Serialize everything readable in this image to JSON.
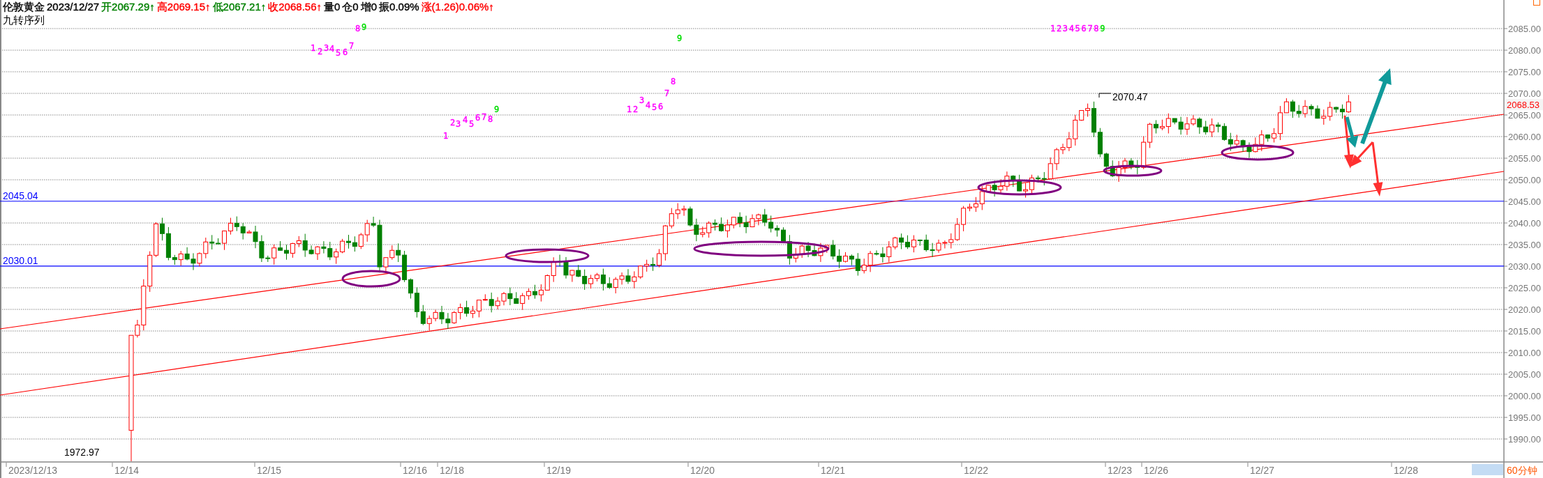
{
  "header": {
    "items": [
      {
        "text": "伦敦黄金",
        "color": "#000000"
      },
      {
        "text": "2023/12/27",
        "color": "#000000"
      },
      {
        "text": "开2067.29↑",
        "color": "#008000"
      },
      {
        "text": "高2069.15↑",
        "color": "#ff0000"
      },
      {
        "text": "低2067.21↑",
        "color": "#008000"
      },
      {
        "text": "收2068.56↑",
        "color": "#ff0000"
      },
      {
        "text": "量0",
        "color": "#000000"
      },
      {
        "text": "仓0",
        "color": "#000000"
      },
      {
        "text": "增0",
        "color": "#000000"
      },
      {
        "text": "振0.09%",
        "color": "#000000"
      },
      {
        "text": "涨(1.26)0.06%↑",
        "color": "#ff0000"
      }
    ],
    "indicator": "九转序列"
  },
  "nine_sequences": [
    {
      "digits": [
        {
          "text": "1",
          "color": "#ff00ff"
        },
        {
          "text": "2",
          "color": "#ff00ff"
        },
        {
          "text": "3",
          "color": "#ff00ff"
        },
        {
          "text": "4",
          "color": "#ff00ff"
        },
        {
          "text": "5",
          "color": "#ff00ff"
        },
        {
          "text": "6",
          "color": "#ff00ff"
        },
        {
          "text": "7",
          "color": "#ff00ff"
        },
        {
          "text": "8",
          "color": "#ff00ff"
        },
        {
          "text": "9",
          "color": "#00dd00"
        }
      ]
    },
    {
      "digits": [
        {
          "text": "1",
          "color": "#ff00ff"
        },
        {
          "text": "2",
          "color": "#ff00ff"
        },
        {
          "text": "3",
          "color": "#ff00ff"
        },
        {
          "text": "4",
          "color": "#ff00ff"
        },
        {
          "text": "5",
          "color": "#ff00ff"
        },
        {
          "text": "6",
          "color": "#ff00ff"
        },
        {
          "text": "7",
          "color": "#ff00ff"
        },
        {
          "text": "8",
          "color": "#ff00ff"
        },
        {
          "text": "9",
          "color": "#00dd00"
        }
      ]
    },
    {
      "digits": [
        {
          "text": "1",
          "color": "#ff00ff"
        },
        {
          "text": "2",
          "color": "#ff00ff"
        },
        {
          "text": "3",
          "color": "#ff00ff"
        },
        {
          "text": "4",
          "color": "#ff00ff"
        },
        {
          "text": "5",
          "color": "#ff00ff"
        },
        {
          "text": "6",
          "color": "#ff00ff"
        },
        {
          "text": "7",
          "color": "#ff00ff"
        },
        {
          "text": "8",
          "color": "#ff00ff"
        },
        {
          "text": "9",
          "color": "#00dd00"
        }
      ]
    },
    {
      "digits": [
        {
          "text": "1",
          "color": "#ff00ff"
        },
        {
          "text": "2",
          "color": "#ff00ff"
        },
        {
          "text": "3",
          "color": "#ff00ff"
        },
        {
          "text": "4",
          "color": "#ff00ff"
        },
        {
          "text": "5",
          "color": "#ff00ff"
        },
        {
          "text": "6",
          "color": "#ff00ff"
        },
        {
          "text": "7",
          "color": "#ff00ff"
        },
        {
          "text": "8",
          "color": "#ff00ff"
        },
        {
          "text": "9",
          "color": "#00dd00"
        }
      ]
    }
  ],
  "price_axis": {
    "labels": [
      "2085.00",
      "2080.00",
      "2075.00",
      "2070.00",
      "2065.00",
      "2060.00",
      "2055.00",
      "2050.00",
      "2045.00",
      "2040.00",
      "2035.00",
      "2030.00",
      "2025.00",
      "2020.00",
      "2015.00",
      "2010.00",
      "2005.00",
      "2000.00",
      "1995.00",
      "1990.00"
    ],
    "last_price": "2068.53"
  },
  "levels": [
    {
      "label": "2045.04"
    },
    {
      "label": "2030.01"
    }
  ],
  "annotations": {
    "high": "2070.47",
    "low": "1972.97"
  },
  "time_axis": {
    "labels": [
      "2023/12/13",
      "12/14",
      "12/15",
      "12/16",
      "12/18",
      "12/19",
      "12/20",
      "12/21",
      "12/22",
      "12/23",
      "12/26",
      "12/27",
      "12/28"
    ]
  },
  "period": "60分钟"
}
